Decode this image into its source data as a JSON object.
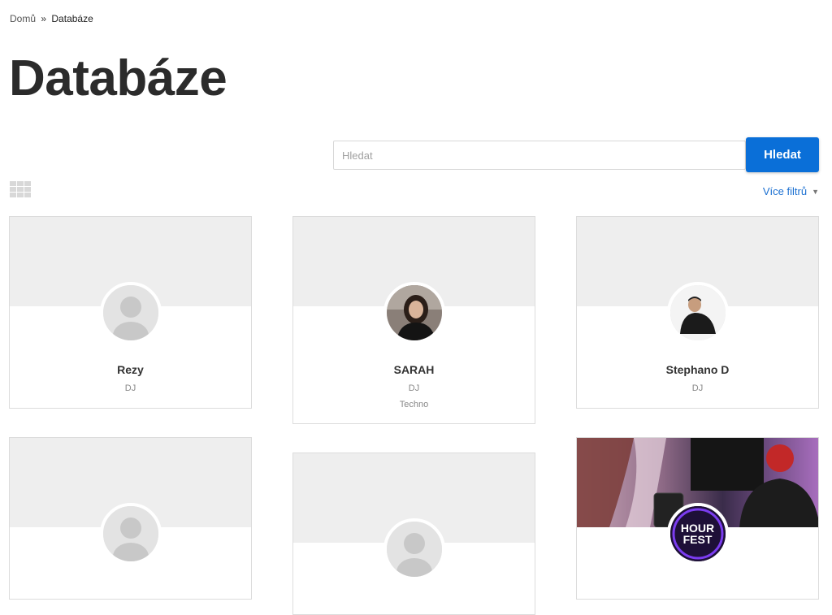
{
  "breadcrumb": {
    "home": "Domů",
    "separator": "»",
    "current": "Databáze"
  },
  "page_title": "Databáze",
  "search": {
    "placeholder": "Hledat",
    "value": "",
    "button_label": "Hledat"
  },
  "filters": {
    "more_label": "Více filtrů"
  },
  "colors": {
    "accent": "#0a6fd8",
    "link": "#1a6fd1",
    "cover_placeholder": "#eeeeee"
  },
  "cards": [
    {
      "name": "Rezy",
      "role": "DJ",
      "genre": "",
      "avatar": "placeholder-avatar-icon"
    },
    {
      "name": "SARAH",
      "role": "DJ",
      "genre": "Techno",
      "avatar": "photo"
    },
    {
      "name": "Stephano D",
      "role": "DJ",
      "genre": "",
      "avatar": "photo"
    },
    {
      "name": "",
      "role": "",
      "genre": "",
      "avatar": "placeholder-avatar-icon"
    },
    {
      "name": "",
      "role": "",
      "genre": "",
      "avatar": "placeholder-avatar-icon"
    },
    {
      "name": "",
      "role": "",
      "genre": "",
      "avatar": "hourfest-logo",
      "logo_text": "HOUR FEST"
    }
  ]
}
